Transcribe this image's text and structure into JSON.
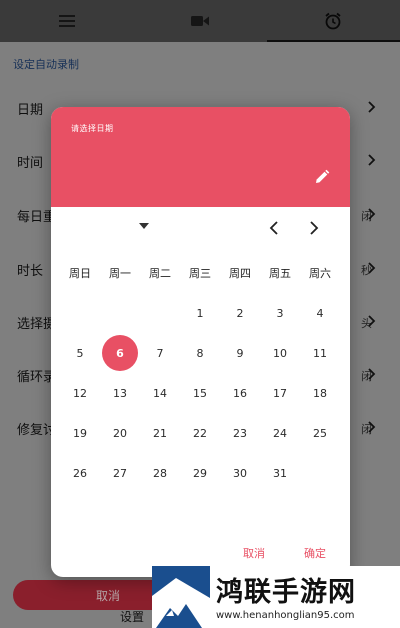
{
  "topbar": {
    "tabs": [
      {
        "icon": "menu-icon"
      },
      {
        "icon": "video-camera-icon"
      },
      {
        "icon": "alarm-clock-icon",
        "active": true
      }
    ]
  },
  "background": {
    "section_header": "设定自动录制",
    "rows": [
      {
        "label": "日期",
        "value": ""
      },
      {
        "label": "时间",
        "value": ""
      },
      {
        "label": "每日重",
        "value": "闭"
      },
      {
        "label": "时长",
        "value": "秒"
      },
      {
        "label": "选择摄",
        "value": "头"
      },
      {
        "label": "循环录",
        "value": "闭"
      },
      {
        "label": "修复讨",
        "value": "闭"
      }
    ],
    "cancel_label": "取消",
    "setting_label": "设置"
  },
  "dialog": {
    "title": "请选择日期",
    "weekdays": [
      "周日",
      "周一",
      "周二",
      "周三",
      "周四",
      "周五",
      "周六"
    ],
    "weeks": [
      [
        "",
        "",
        "",
        "1",
        "2",
        "3",
        "4"
      ],
      [
        "5",
        "6",
        "7",
        "8",
        "9",
        "10",
        "11"
      ],
      [
        "12",
        "13",
        "14",
        "15",
        "16",
        "17",
        "18"
      ],
      [
        "19",
        "20",
        "21",
        "22",
        "23",
        "24",
        "25"
      ],
      [
        "26",
        "27",
        "28",
        "29",
        "30",
        "31",
        ""
      ]
    ],
    "selected_day": "6",
    "cancel_label": "取消",
    "ok_label": "确定",
    "accent_color": "#e85064"
  },
  "watermark": {
    "text": "鸿联手游网",
    "url": "www.henanhonglian95.com"
  }
}
